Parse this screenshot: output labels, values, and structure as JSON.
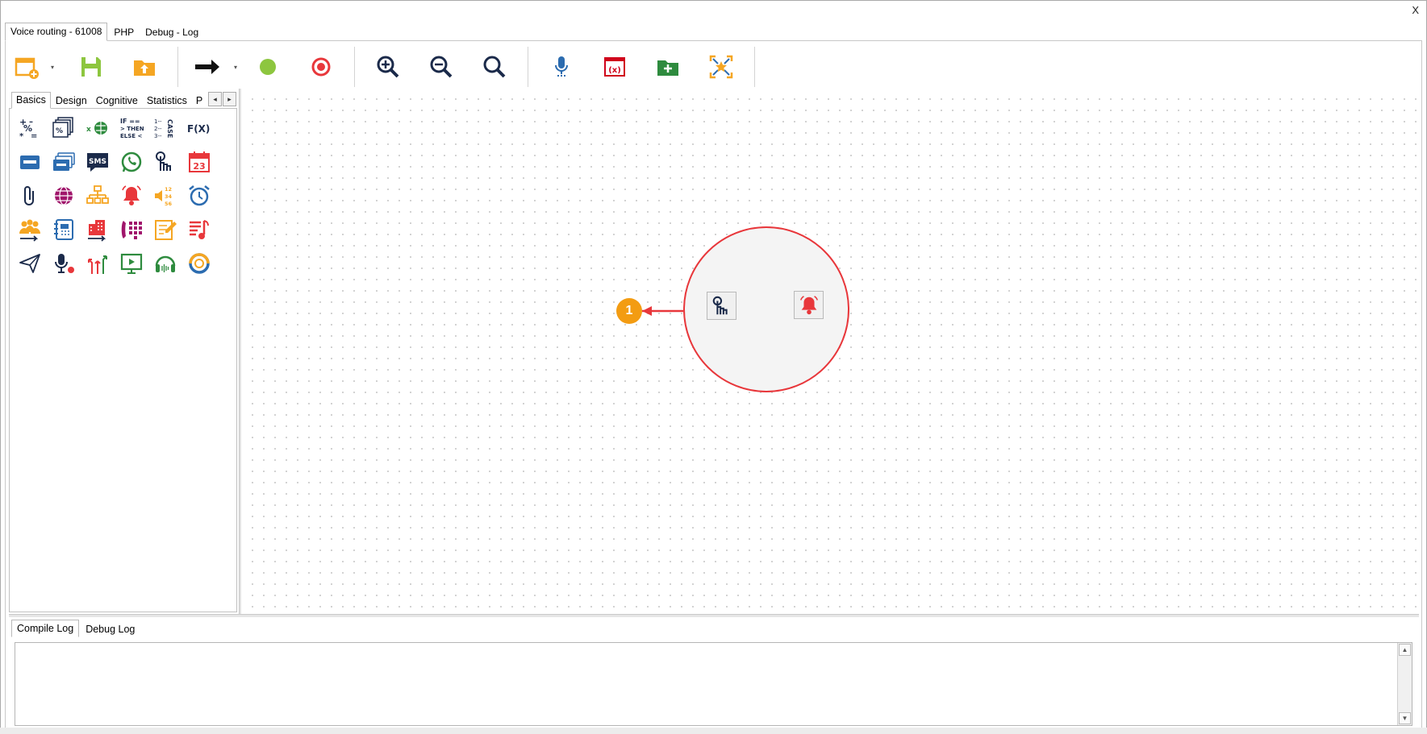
{
  "window": {
    "close_label": "X"
  },
  "top_tabs": [
    {
      "label": "Voice routing - 61008",
      "active": true
    },
    {
      "label": "PHP",
      "active": false
    },
    {
      "label": "Debug - Log",
      "active": false
    }
  ],
  "toolbar": {
    "buttons": [
      {
        "icon": "new-window-icon",
        "has_dropdown": true
      },
      {
        "icon": "save-icon"
      },
      {
        "icon": "upload-folder-icon"
      },
      {
        "icon": "arrow-right-icon",
        "has_dropdown": true
      },
      {
        "icon": "green-dot-icon"
      },
      {
        "icon": "target-icon"
      },
      {
        "icon": "zoom-in-icon"
      },
      {
        "icon": "zoom-out-icon"
      },
      {
        "icon": "search-icon"
      },
      {
        "icon": "microphone-icon"
      },
      {
        "icon": "variable-window-icon"
      },
      {
        "icon": "add-folder-icon"
      },
      {
        "icon": "fit-view-icon"
      }
    ]
  },
  "palette": {
    "tabs": [
      {
        "label": "Basics",
        "active": true
      },
      {
        "label": "Design",
        "active": false
      },
      {
        "label": "Cognitive",
        "active": false
      },
      {
        "label": "Statistics",
        "active": false
      },
      {
        "label": "Pı",
        "active": false
      }
    ],
    "nav_prev": "◂",
    "nav_next": "▸",
    "items": [
      "calculator-icon",
      "percent-stack-icon",
      "web-export-icon",
      "if-then-else-icon",
      "case-icon",
      "function-icon",
      "voicemail-icon",
      "voicemail-stack-icon",
      "sms-icon",
      "whatsapp-icon",
      "touch-tone-icon",
      "calendar-icon",
      "attachment-icon",
      "globe-icon",
      "org-chart-icon",
      "bell-icon",
      "speaker-numbers-icon",
      "alarm-clock-icon",
      "group-transfer-icon",
      "phone-book-icon",
      "building-transfer-icon",
      "phone-keypad-icon",
      "notepad-icon",
      "music-list-icon",
      "send-icon",
      "record-mic-icon",
      "split-arrows-icon",
      "screen-play-icon",
      "headset-icon",
      "progress-ring-icon"
    ],
    "text": {
      "if_line1": "IF ==",
      "if_line2": "> THEN",
      "if_line3": "ELSE <",
      "case": "CASE",
      "fx": "F(X)",
      "sms": "SMS",
      "cal": "23",
      "nums": "12 34 56"
    }
  },
  "canvas": {
    "badge_label": "1",
    "nodes": [
      {
        "icon": "touch-tone-icon"
      },
      {
        "icon": "bell-icon"
      }
    ]
  },
  "log": {
    "tabs": [
      {
        "label": "Compile Log",
        "active": true
      },
      {
        "label": "Debug Log",
        "active": false
      }
    ],
    "content": ""
  },
  "colors": {
    "accent_red": "#e8373b",
    "badge_orange": "#f39c12",
    "save_green": "#8dc63f",
    "folder_orange": "#f5a623",
    "navy": "#1b2a4a"
  }
}
